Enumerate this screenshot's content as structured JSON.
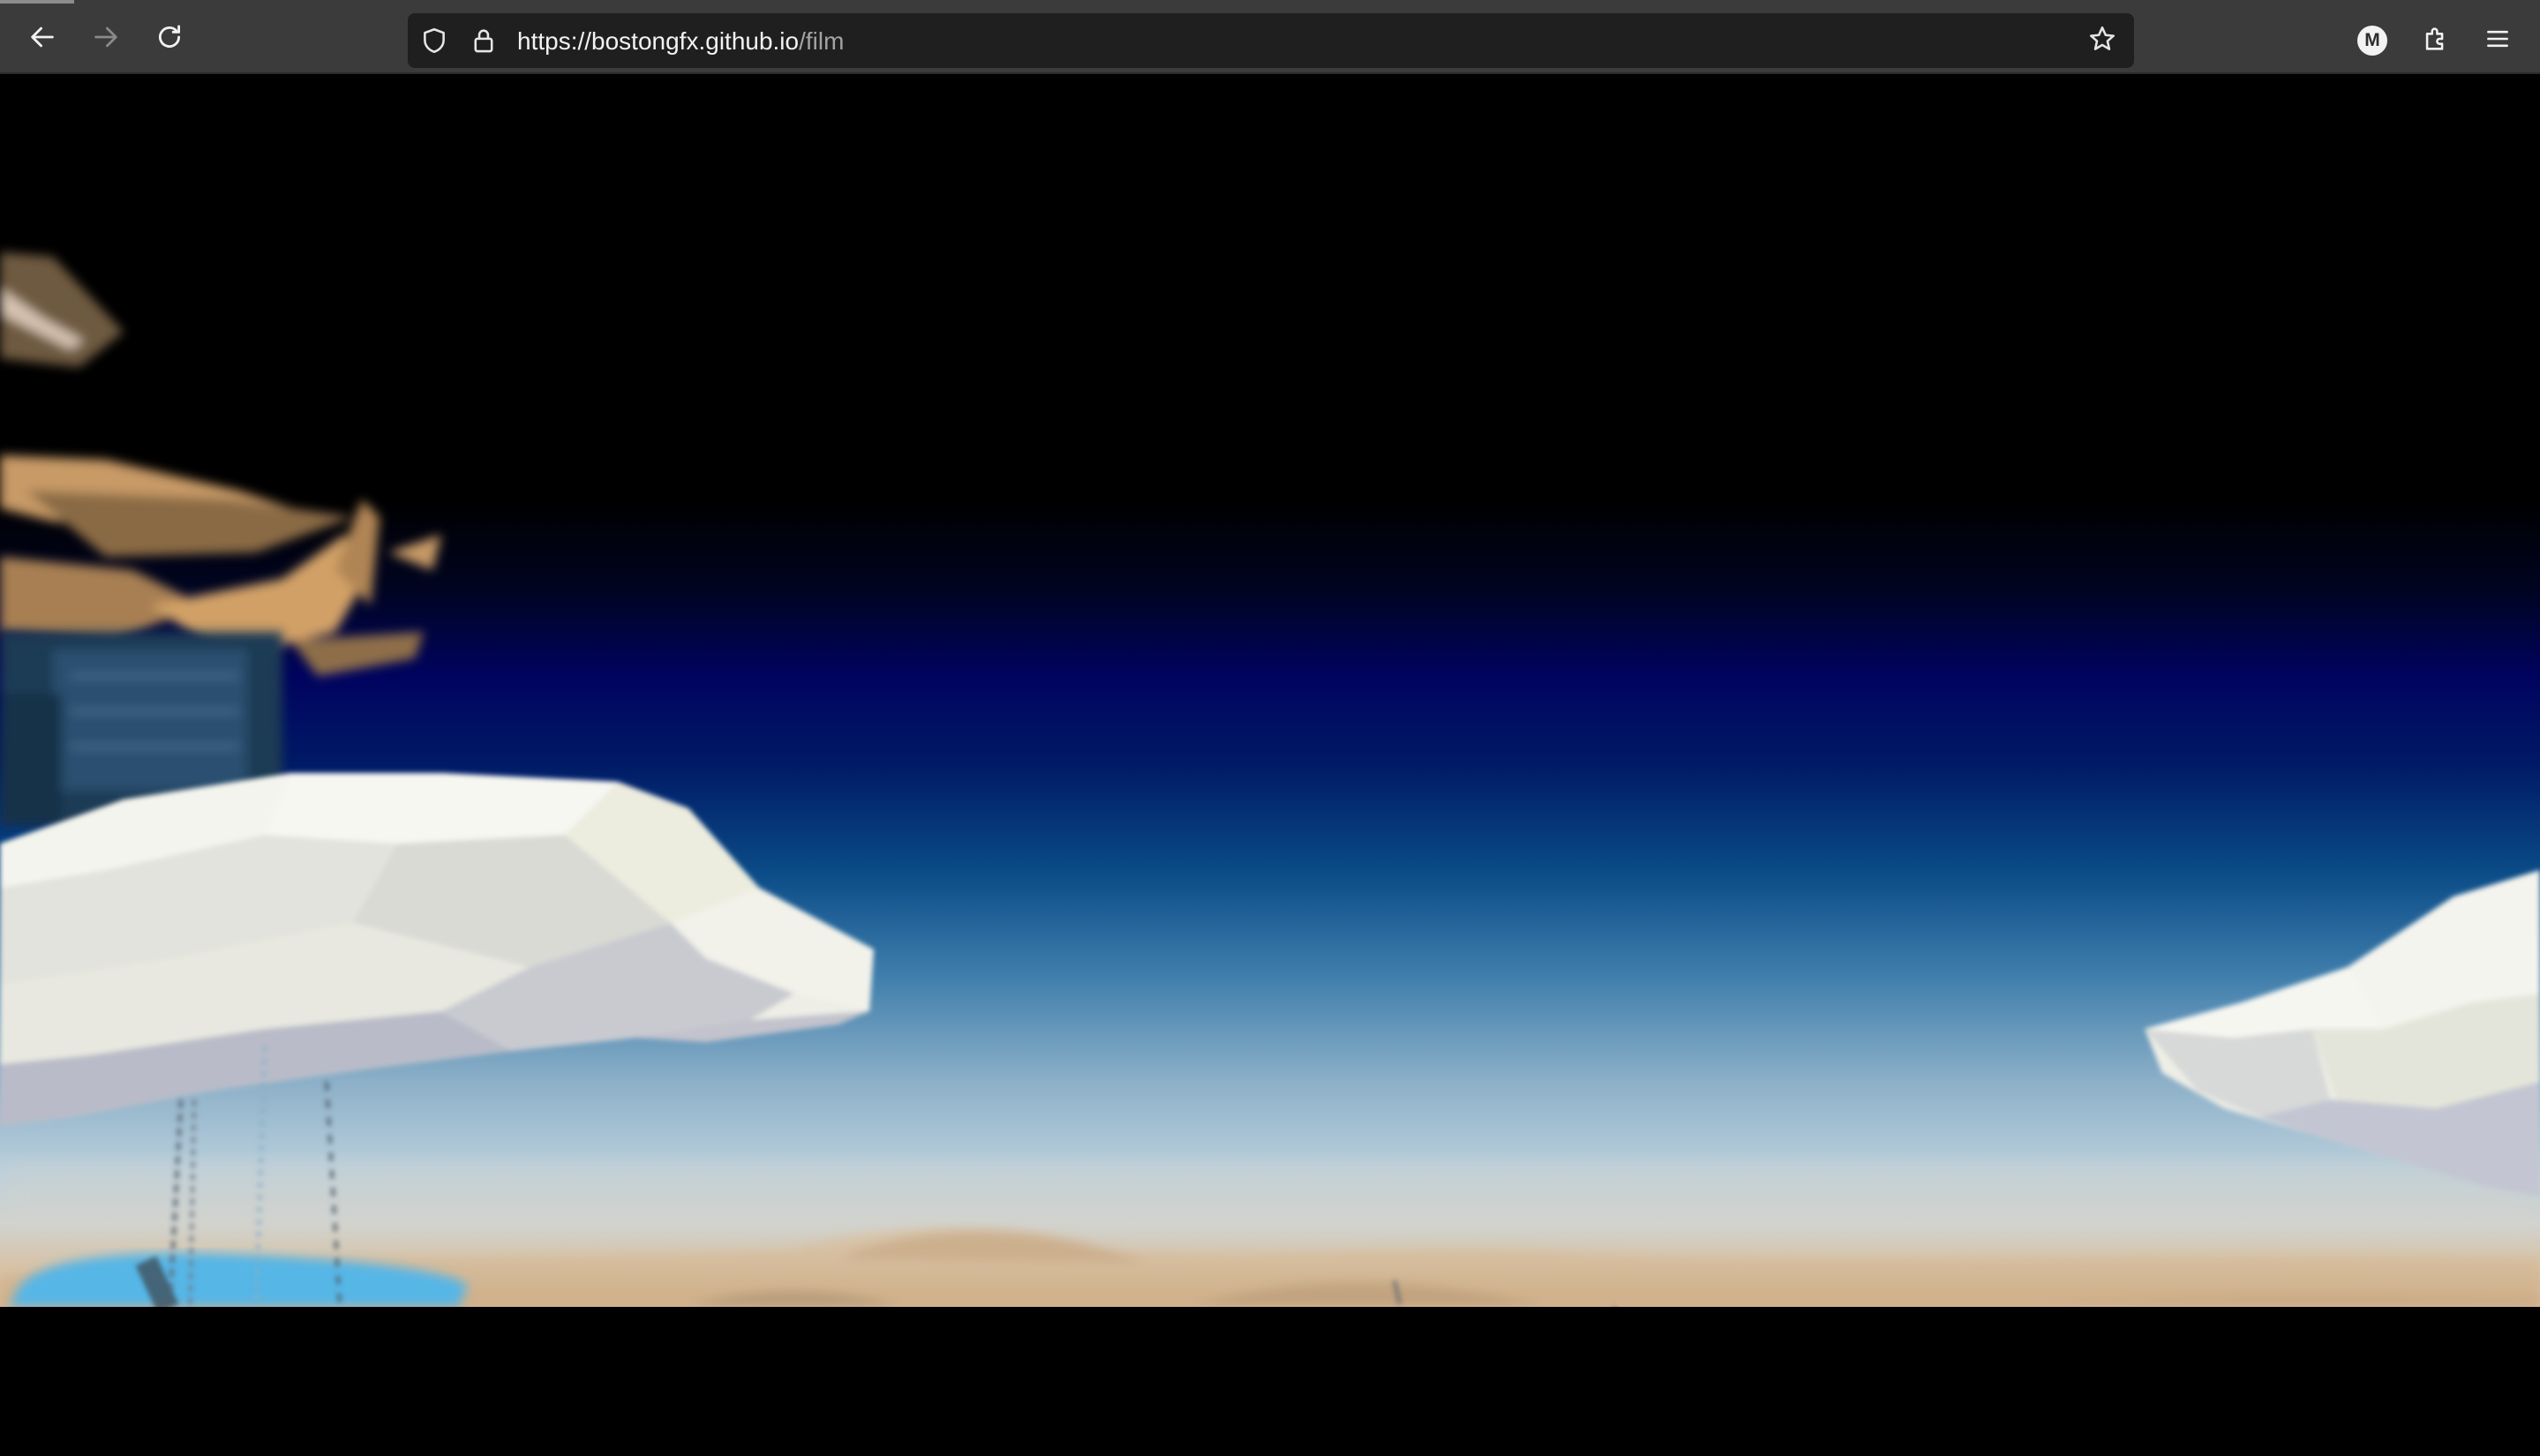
{
  "browser": {
    "url_host": "https://bostongfx.github.io",
    "url_path": "/film",
    "profile_initial": "M",
    "buttons": {
      "back": "back-arrow-icon",
      "forward": "forward-arrow-icon",
      "reload": "reload-icon",
      "tracking_protection": "shield-icon",
      "site_security": "lock-icon",
      "bookmark": "star-icon",
      "account": "account-avatar",
      "extensions": "puzzle-icon",
      "menu": "hamburger-menu-icon"
    }
  },
  "page": {
    "scene": "3d-animated-film-scene",
    "colors": {
      "sky_top": "#000000",
      "sky_mid": "#00035e",
      "sky_low": "#8cb0c8",
      "ground": "#d6b898",
      "cloud": "#eeeee6",
      "letterbox": "#000000"
    }
  }
}
